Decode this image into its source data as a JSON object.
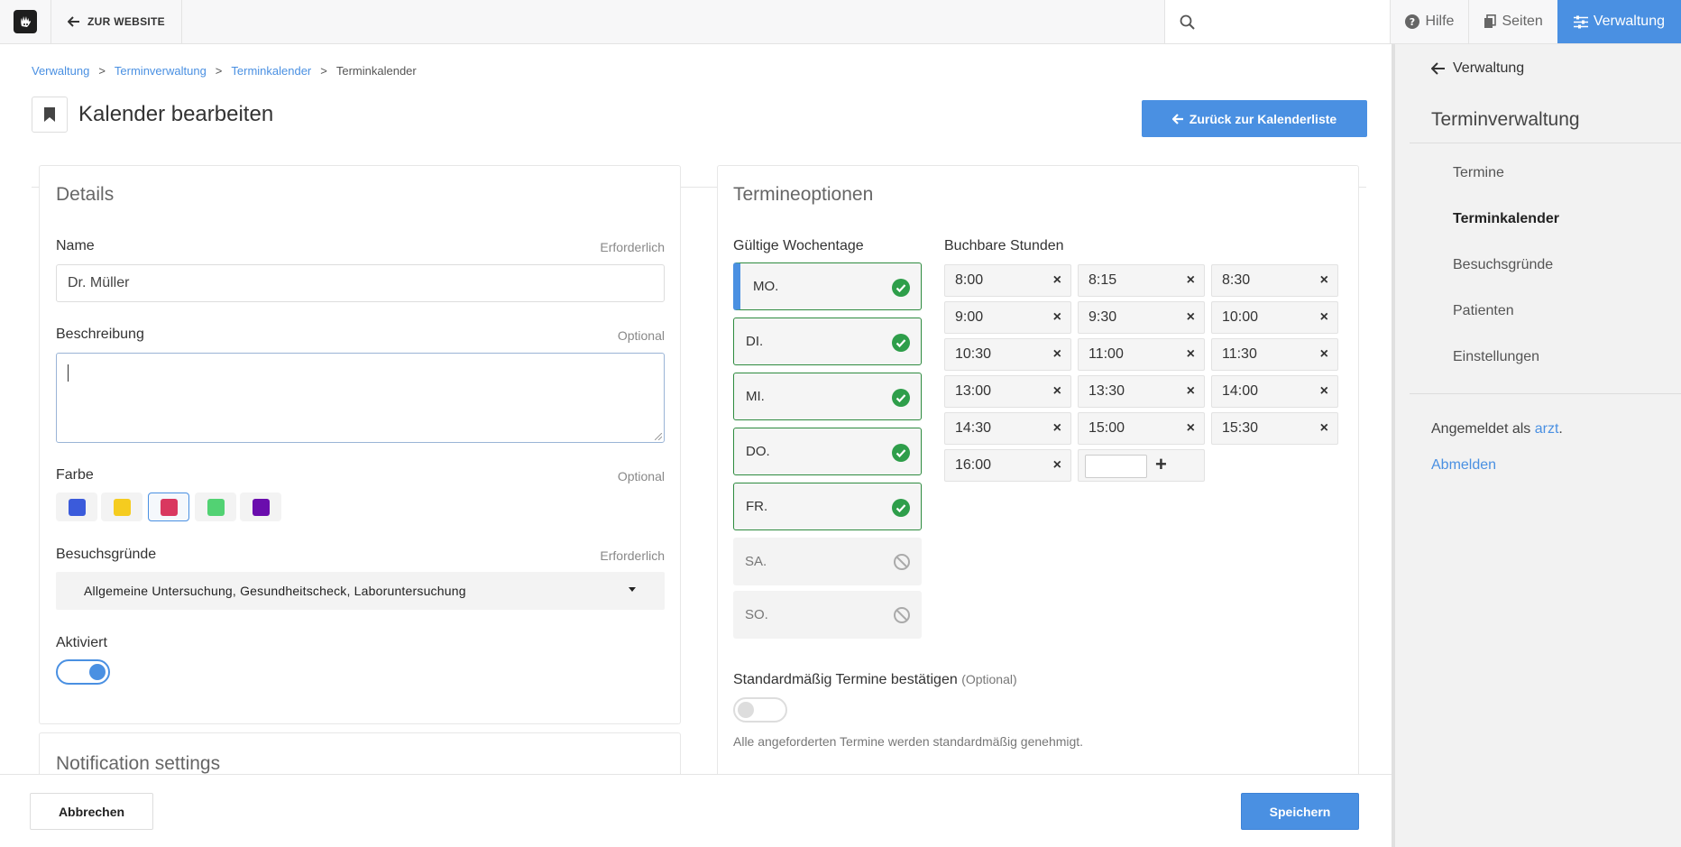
{
  "topbar": {
    "to_website": "ZUR WEBSITE",
    "help": "Hilfe",
    "pages": "Seiten",
    "admin": "Verwaltung"
  },
  "breadcrumb": [
    "Verwaltung",
    "Terminverwaltung",
    "Terminkalender",
    "Terminkalender"
  ],
  "page_title": "Kalender bearbeiten",
  "back_button": "Zurück zur Kalenderliste",
  "details": {
    "title": "Details",
    "name_label": "Name",
    "name_hint": "Erforderlich",
    "name_value": "Dr. Müller",
    "desc_label": "Beschreibung",
    "desc_hint": "Optional",
    "color_label": "Farbe",
    "color_hint": "Optional",
    "colors": [
      "#3b5bdb",
      "#f5cc1f",
      "#d9375f",
      "#52d273",
      "#6a0dad"
    ],
    "selected_color_index": 2,
    "reasons_label": "Besuchsgründe",
    "reasons_hint": "Erforderlich",
    "reasons_value": "Allgemeine Untersuchung, Gesundheitscheck, Laboruntersuchung",
    "active_label": "Aktiviert",
    "active": true
  },
  "notification_title": "Notification settings",
  "options": {
    "title": "Termineoptionen",
    "weekdays_label": "Gültige Wochentage",
    "hours_label": "Buchbare Stunden",
    "days": [
      {
        "label": "MO.",
        "enabled": true
      },
      {
        "label": "DI.",
        "enabled": true
      },
      {
        "label": "MI.",
        "enabled": true
      },
      {
        "label": "DO.",
        "enabled": true
      },
      {
        "label": "FR.",
        "enabled": true
      },
      {
        "label": "SA.",
        "enabled": false
      },
      {
        "label": "SO.",
        "enabled": false
      }
    ],
    "slots": [
      "8:00",
      "8:15",
      "8:30",
      "9:00",
      "9:30",
      "10:00",
      "10:30",
      "11:00",
      "11:30",
      "13:00",
      "13:30",
      "14:00",
      "14:30",
      "15:00",
      "15:30",
      "16:00"
    ],
    "confirm_label": "Standardmäßig Termine bestätigen",
    "confirm_hint": "(Optional)",
    "confirm_on": false,
    "confirm_desc": "Alle angeforderten Termine werden standardmäßig genehmigt."
  },
  "footer": {
    "cancel": "Abbrechen",
    "save": "Speichern"
  },
  "sidebar": {
    "back": "Verwaltung",
    "title": "Terminverwaltung",
    "items": [
      "Termine",
      "Terminkalender",
      "Besuchsgründe",
      "Patienten",
      "Einstellungen"
    ],
    "active_index": 1,
    "logged_in_as": "Angemeldet als",
    "user": "arzt",
    "logout": "Abmelden"
  },
  "colors": {
    "accent": "#4a90e2",
    "check_green": "#2e9e4a"
  }
}
